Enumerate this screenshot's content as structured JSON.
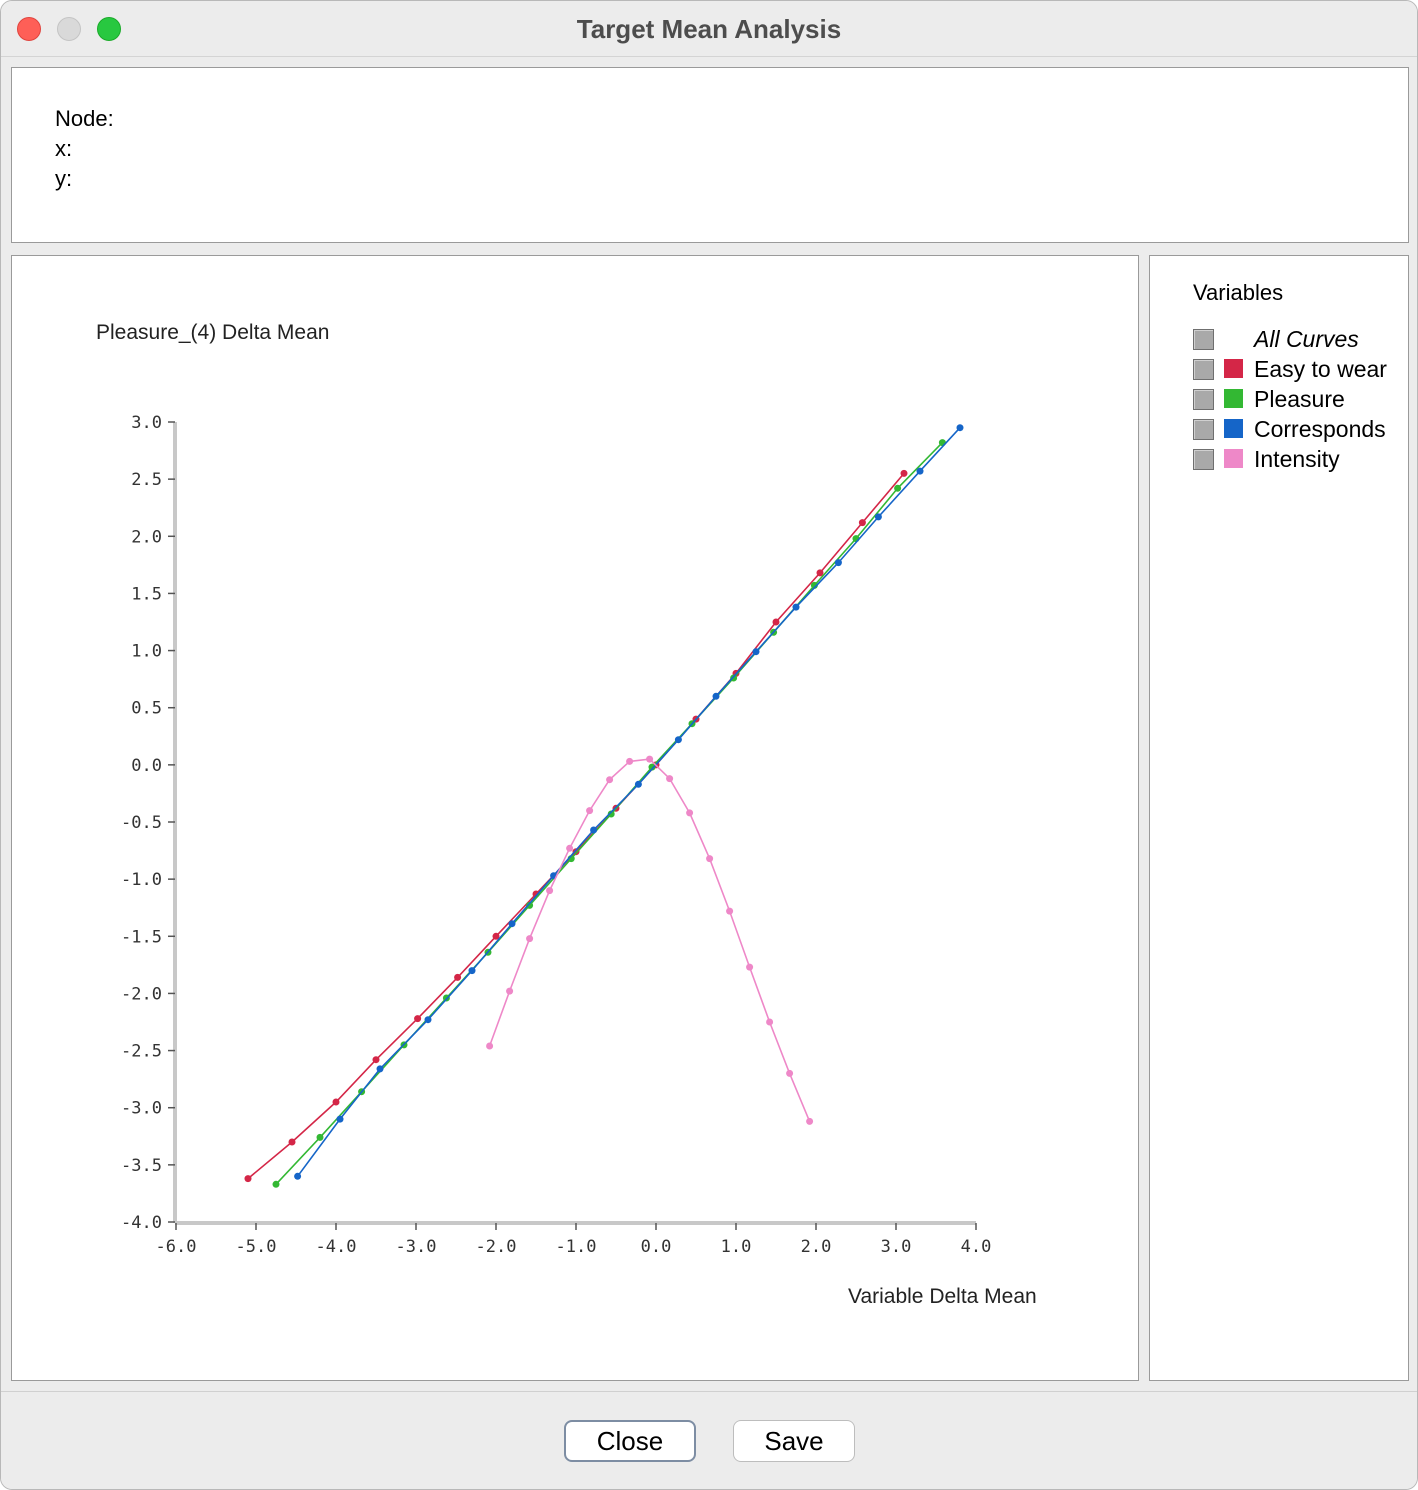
{
  "window": {
    "title": "Target Mean Analysis"
  },
  "info": {
    "node_label": "Node:",
    "x_label": "x:",
    "y_label": "y:"
  },
  "legend": {
    "title": "Variables",
    "all_curves_label": "All Curves",
    "items": [
      {
        "label": "Easy to wear",
        "color": "#d42647"
      },
      {
        "label": "Pleasure",
        "color": "#33b833"
      },
      {
        "label": "Corresponds",
        "color": "#1565c8"
      },
      {
        "label": "Intensity",
        "color": "#ee88c8"
      }
    ]
  },
  "buttons": {
    "close_label": "Close",
    "save_label": "Save"
  },
  "chart_data": {
    "type": "line",
    "title": "Pleasure_(4) Delta Mean",
    "xlabel": "Variable Delta Mean",
    "ylabel": "Pleasure_(4) Delta Mean",
    "xlim": [
      -6.0,
      4.0
    ],
    "ylim": [
      -4.0,
      3.0
    ],
    "x_ticks": [
      "-6.0",
      "-5.0",
      "-4.0",
      "-3.0",
      "-2.0",
      "-1.0",
      "0.0",
      "1.0",
      "2.0",
      "3.0",
      "4.0"
    ],
    "y_ticks": [
      "3.0",
      "2.5",
      "2.0",
      "1.5",
      "1.0",
      "0.5",
      "0.0",
      "-0.5",
      "-1.0",
      "-1.5",
      "-2.0",
      "-2.5",
      "-3.0",
      "-3.5",
      "-4.0"
    ],
    "grid": false,
    "legend_position": "right-panel",
    "series": [
      {
        "name": "Easy to wear",
        "color": "#d42647",
        "points": [
          [
            -5.1,
            -3.62
          ],
          [
            -4.55,
            -3.3
          ],
          [
            -4.0,
            -2.95
          ],
          [
            -3.5,
            -2.58
          ],
          [
            -2.98,
            -2.22
          ],
          [
            -2.48,
            -1.86
          ],
          [
            -2.0,
            -1.5
          ],
          [
            -1.5,
            -1.13
          ],
          [
            -1.0,
            -0.76
          ],
          [
            -0.5,
            -0.38
          ],
          [
            0.0,
            0.0
          ],
          [
            0.5,
            0.4
          ],
          [
            1.0,
            0.8
          ],
          [
            1.5,
            1.25
          ],
          [
            2.05,
            1.68
          ],
          [
            2.58,
            2.12
          ],
          [
            3.1,
            2.55
          ]
        ]
      },
      {
        "name": "Pleasure",
        "color": "#33b833",
        "points": [
          [
            -4.75,
            -3.67
          ],
          [
            -4.2,
            -3.26
          ],
          [
            -3.68,
            -2.86
          ],
          [
            -3.15,
            -2.45
          ],
          [
            -2.62,
            -2.04
          ],
          [
            -2.1,
            -1.64
          ],
          [
            -1.58,
            -1.23
          ],
          [
            -1.06,
            -0.82
          ],
          [
            -0.56,
            -0.43
          ],
          [
            -0.05,
            -0.02
          ],
          [
            0.45,
            0.36
          ],
          [
            0.97,
            0.76
          ],
          [
            1.47,
            1.16
          ],
          [
            1.98,
            1.57
          ],
          [
            2.5,
            1.98
          ],
          [
            3.02,
            2.42
          ],
          [
            3.58,
            2.82
          ]
        ]
      },
      {
        "name": "Corresponds",
        "color": "#1565c8",
        "points": [
          [
            -4.48,
            -3.6
          ],
          [
            -3.95,
            -3.1
          ],
          [
            -3.45,
            -2.66
          ],
          [
            -2.85,
            -2.23
          ],
          [
            -2.3,
            -1.8
          ],
          [
            -1.8,
            -1.39
          ],
          [
            -1.28,
            -0.97
          ],
          [
            -0.78,
            -0.57
          ],
          [
            -0.22,
            -0.17
          ],
          [
            0.28,
            0.22
          ],
          [
            0.75,
            0.6
          ],
          [
            1.25,
            0.99
          ],
          [
            1.75,
            1.38
          ],
          [
            2.28,
            1.77
          ],
          [
            2.78,
            2.17
          ],
          [
            3.3,
            2.57
          ],
          [
            3.8,
            2.95
          ]
        ]
      },
      {
        "name": "Intensity",
        "color": "#ee88c8",
        "points": [
          [
            -2.08,
            -2.46
          ],
          [
            -1.83,
            -1.98
          ],
          [
            -1.58,
            -1.52
          ],
          [
            -1.33,
            -1.1
          ],
          [
            -1.08,
            -0.73
          ],
          [
            -0.83,
            -0.4
          ],
          [
            -0.58,
            -0.13
          ],
          [
            -0.33,
            0.03
          ],
          [
            -0.08,
            0.05
          ],
          [
            0.17,
            -0.12
          ],
          [
            0.42,
            -0.42
          ],
          [
            0.67,
            -0.82
          ],
          [
            0.92,
            -1.28
          ],
          [
            1.17,
            -1.77
          ],
          [
            1.42,
            -2.25
          ],
          [
            1.67,
            -2.7
          ],
          [
            1.92,
            -3.12
          ]
        ]
      }
    ]
  }
}
